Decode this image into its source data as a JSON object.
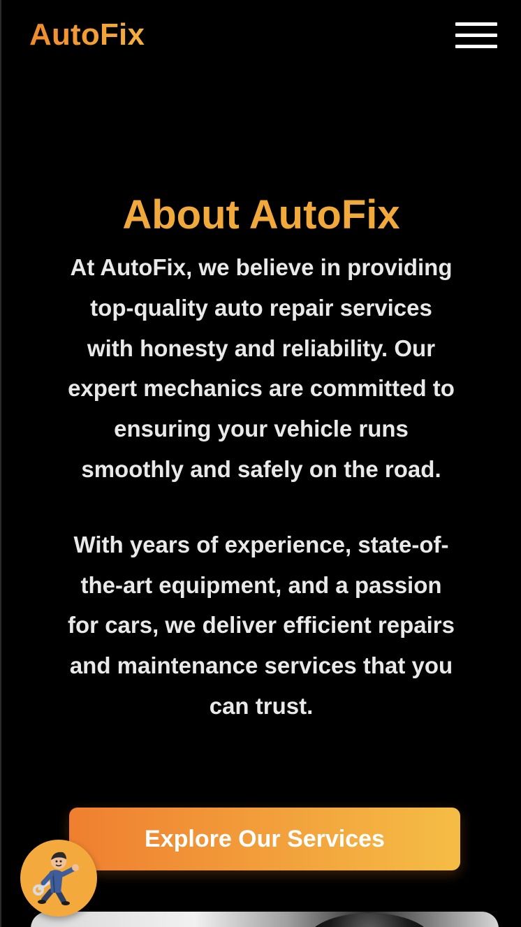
{
  "header": {
    "logo_text": "AutoFix",
    "menu_icon": "hamburger-menu-icon"
  },
  "about": {
    "title": "About AutoFix",
    "paragraph_1": "At AutoFix, we believe in providing top-quality auto repair services with honesty and reliability. Our expert mechanics are committed to ensuring your vehicle runs smoothly and safely on the road.",
    "paragraph_2": "With years of experience, state-of-the-art equipment, and a passion for cars, we deliver efficient repairs and maintenance services that you can trust."
  },
  "cta": {
    "label": "Explore Our Services"
  },
  "chat_avatar": {
    "icon": "mechanic-mascot-icon"
  },
  "colors": {
    "background": "#000000",
    "accent_orange": "#f2a93b",
    "gradient_start": "#ef7f30",
    "gradient_end": "#f5bd45",
    "text": "#e9e9e9"
  }
}
